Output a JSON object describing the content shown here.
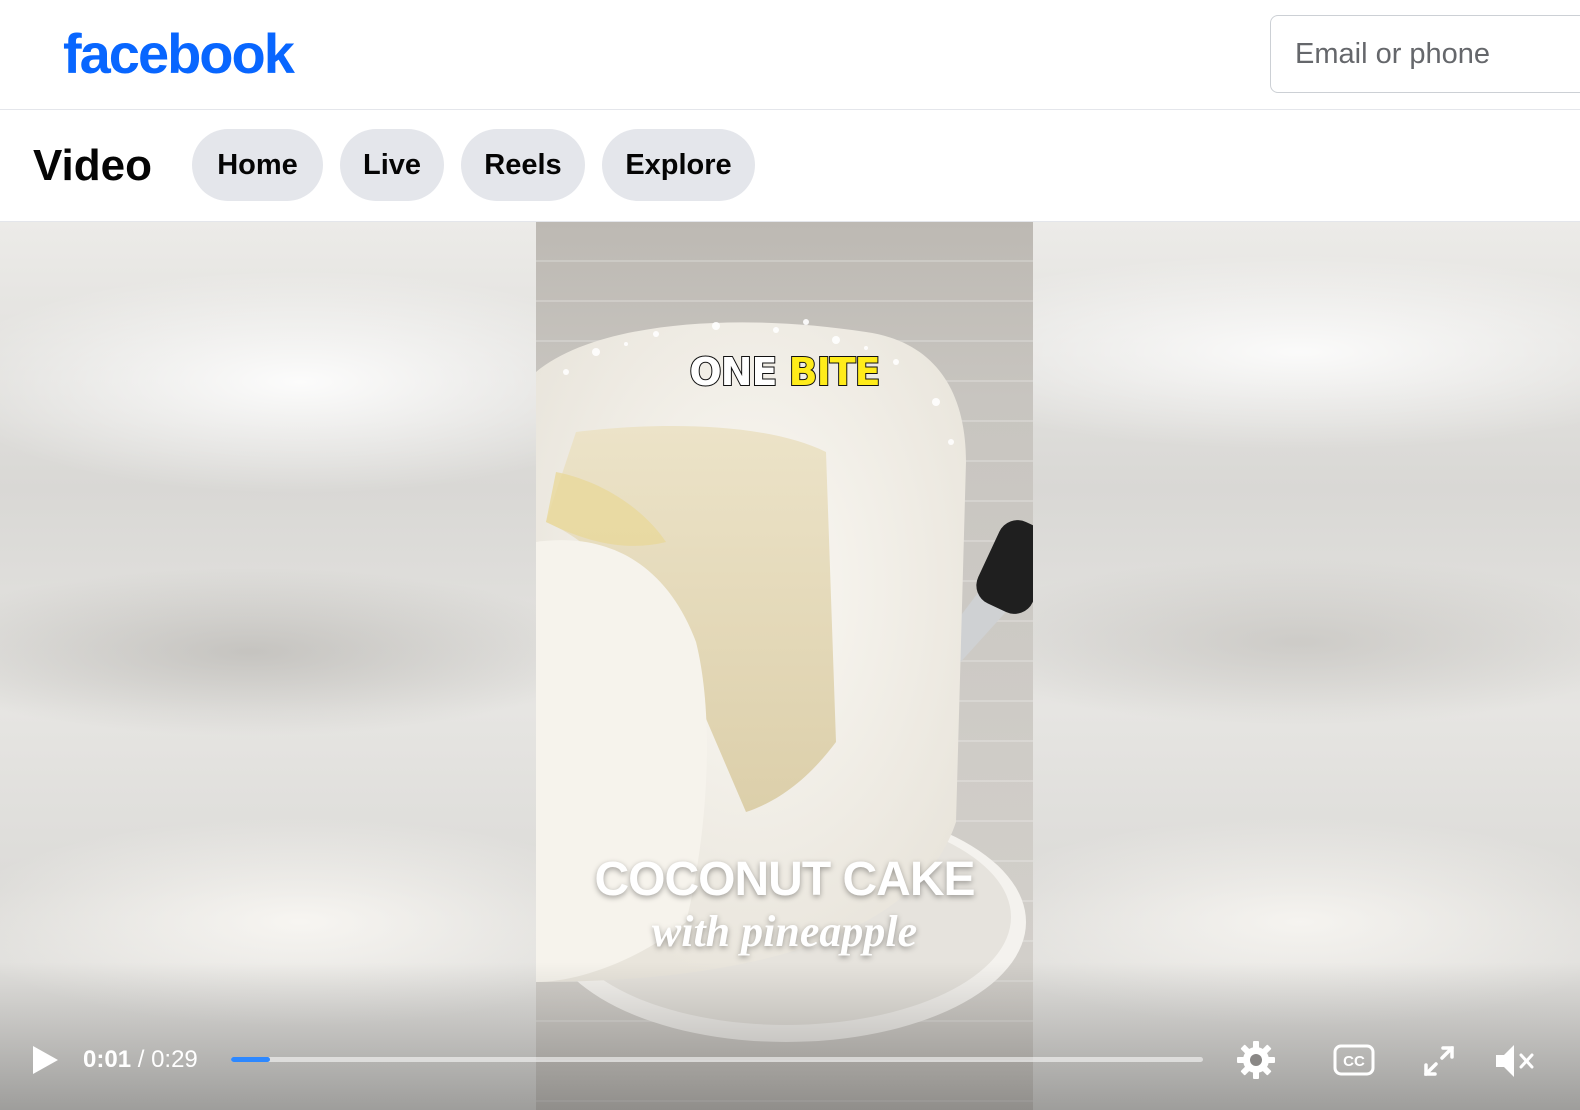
{
  "header": {
    "logo_text": "facebook",
    "login_placeholder": "Email or phone",
    "brand_color": "#0866ff"
  },
  "video_nav": {
    "title": "Video",
    "tabs": [
      {
        "label": "Home"
      },
      {
        "label": "Live"
      },
      {
        "label": "Reels"
      },
      {
        "label": "Explore"
      }
    ]
  },
  "video": {
    "overlay_top_word1": "ONE",
    "overlay_top_word2": "BITE",
    "overlay_title": "COCONUT CAKE",
    "overlay_subtitle": "with pineapple",
    "current_time": "0:01",
    "separator": "/",
    "duration": "0:29",
    "progress_fraction": 0.04,
    "progress_color": "#2d88ff",
    "icons": {
      "play": "play-icon",
      "settings": "gear-icon",
      "captions": "closed-captions-icon",
      "fullscreen": "expand-icon",
      "volume": "muted-speaker-icon"
    }
  }
}
